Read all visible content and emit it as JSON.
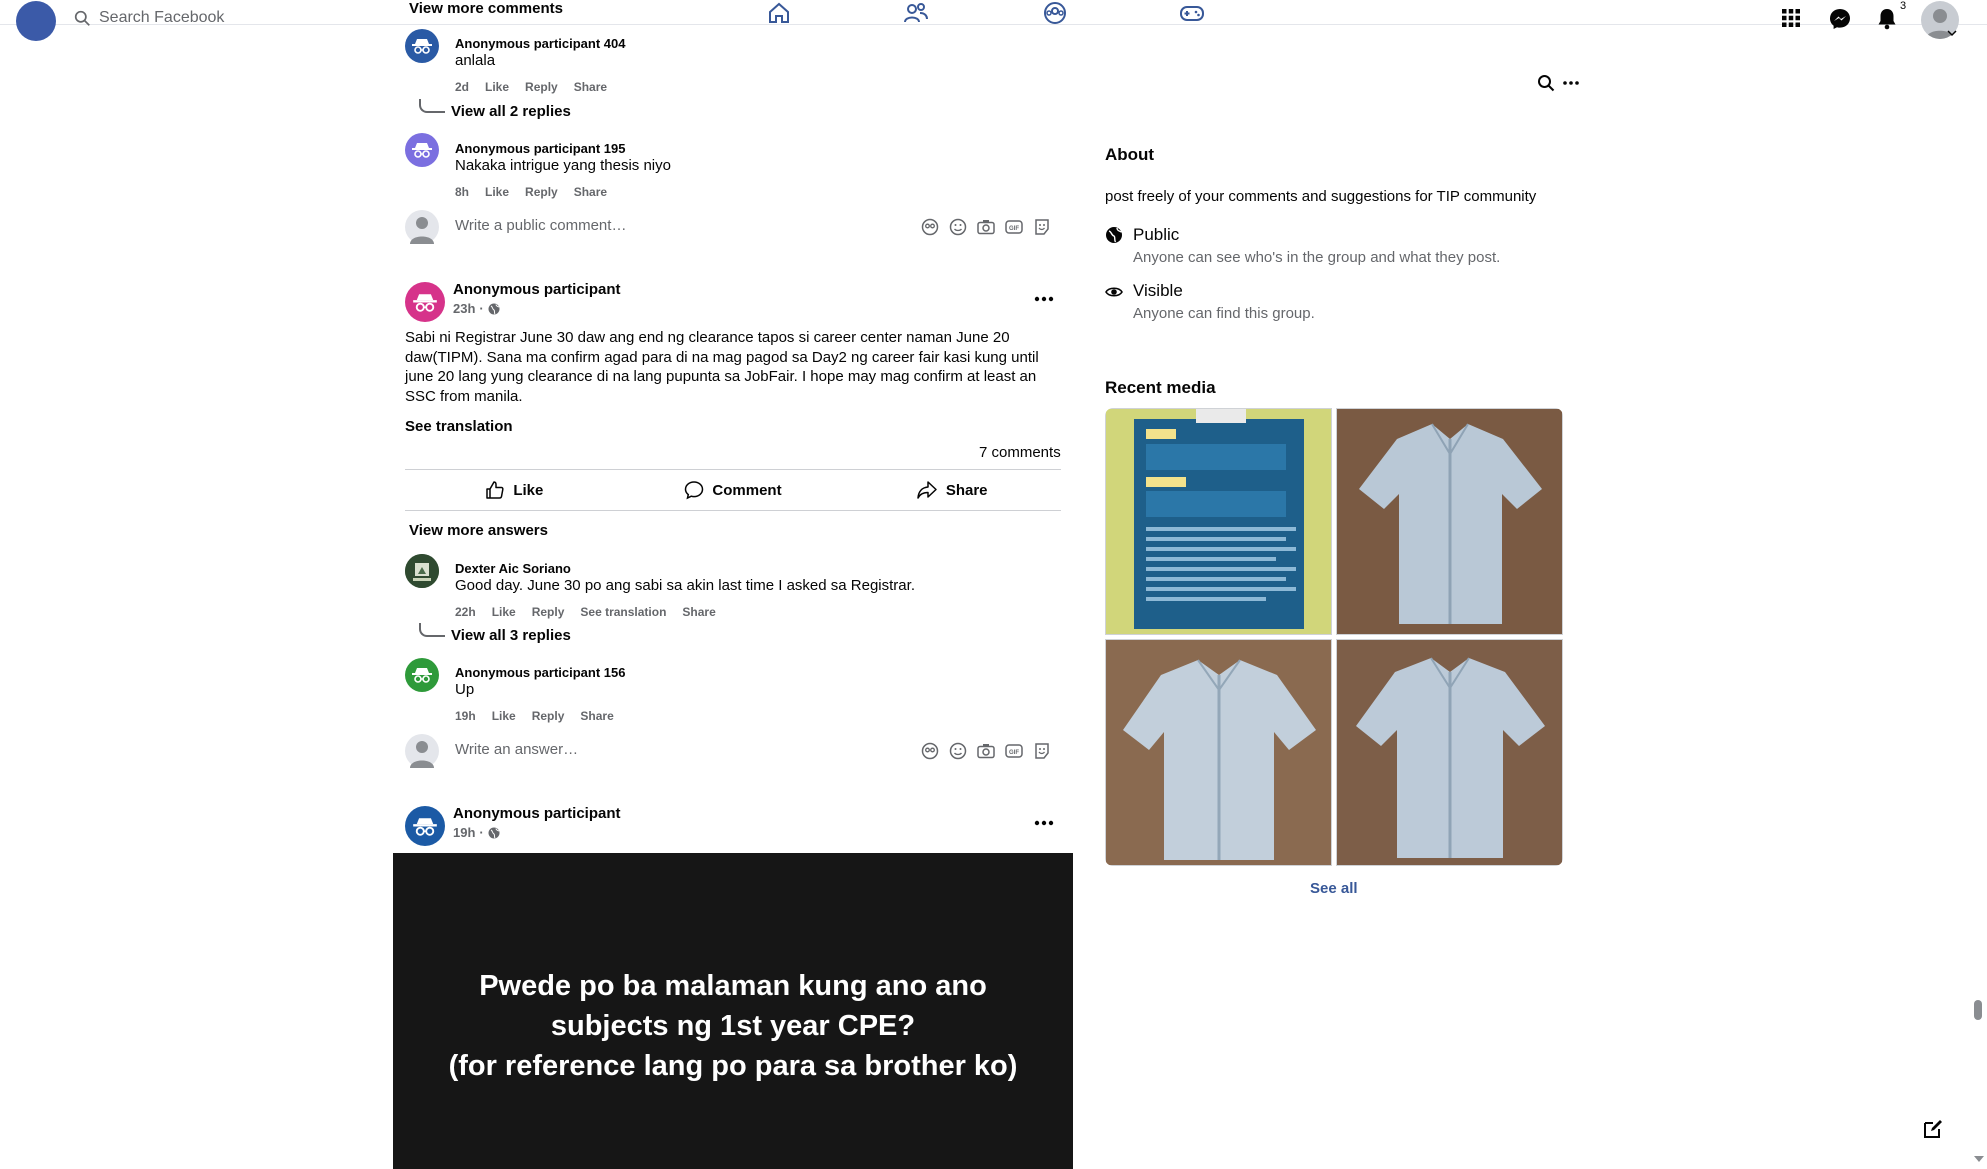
{
  "topbar": {
    "search_placeholder": "Search Facebook",
    "notification_count": "3"
  },
  "feed_top": {
    "view_more_comments": "View more comments"
  },
  "comment_404": {
    "name": "Anonymous participant 404",
    "text": "anlala",
    "time": "2d",
    "like": "Like",
    "reply": "Reply",
    "share": "Share",
    "view_replies": "View all 2 replies"
  },
  "comment_195": {
    "name": "Anonymous participant 195",
    "text": "Nakaka intrigue yang thesis niyo",
    "time": "8h",
    "like": "Like",
    "reply": "Reply",
    "share": "Share"
  },
  "write_comment_1": {
    "placeholder": "Write a public comment…"
  },
  "post_1": {
    "author": "Anonymous participant",
    "time": "23h",
    "body": "Sabi ni Registrar June  30 daw ang end ng clearance tapos si career center naman June 20 daw(TIPM). Sana ma confirm agad para di na mag pagod sa Day2 ng career fair kasi kung until june 20 lang yung clearance di na lang pupunta sa JobFair. I hope may mag confirm at least an SSC from manila.",
    "see_translation": "See translation",
    "comments_count": "7 comments",
    "like_label": "Like",
    "comment_label": "Comment",
    "share_label": "Share",
    "view_more_answers": "View more answers"
  },
  "comment_dexter": {
    "name": "Dexter Aic Soriano",
    "text": "Good day. June 30 po ang sabi sa akin last time I asked sa Registrar.",
    "time": "22h",
    "like": "Like",
    "reply": "Reply",
    "see_translation": "See translation",
    "share": "Share",
    "view_replies": "View all 3 replies"
  },
  "comment_156": {
    "name": "Anonymous participant 156",
    "text": "Up",
    "time": "19h",
    "like": "Like",
    "reply": "Reply",
    "share": "Share"
  },
  "write_answer": {
    "placeholder": "Write an answer…"
  },
  "post_2": {
    "author": "Anonymous participant",
    "time": "19h",
    "image_text": "Pwede po ba malaman kung ano ano\nsubjects ng 1st year CPE?\n(for reference lang po para sa brother ko)"
  },
  "sidebar": {
    "about_title": "About",
    "about_desc": "post freely of your comments and suggestions for TIP community",
    "public_title": "Public",
    "public_sub": "Anyone can see who's in the group and what they post.",
    "visible_title": "Visible",
    "visible_sub": "Anyone can find this group.",
    "recent_media_title": "Recent media",
    "see_all": "See all"
  },
  "colors": {
    "accent_blue": "#385898",
    "secondary_text": "#65676b",
    "avatar_404": "#2a5aa5",
    "avatar_195": "#7b6fe0",
    "avatar_post1": "#d6338a",
    "avatar_156": "#2e9a3a",
    "avatar_post2": "#1b5aa5"
  }
}
